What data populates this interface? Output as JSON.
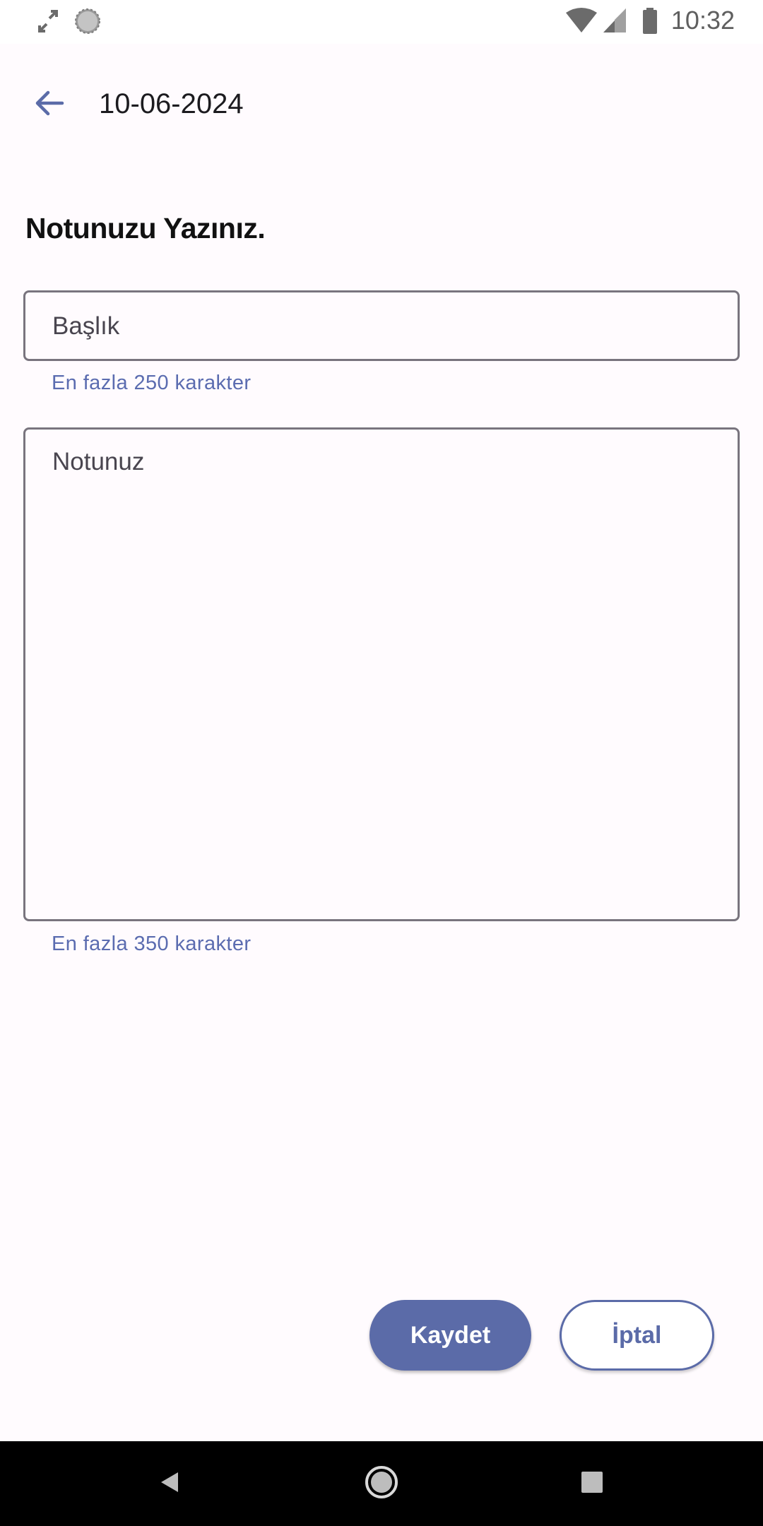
{
  "status_bar": {
    "time": "10:32",
    "left_icons": [
      "screen-rotate-icon",
      "sync-icon"
    ],
    "right_icons": [
      "wifi-icon",
      "cell-signal-icon",
      "battery-icon"
    ]
  },
  "app_bar": {
    "title": "10-06-2024",
    "back_icon": "arrow-back-icon"
  },
  "form": {
    "heading": "Notunuzu Yazınız.",
    "title_field": {
      "placeholder": "Başlık",
      "value": "",
      "helper": "En fazla 250 karakter"
    },
    "note_field": {
      "placeholder": "Notunuz",
      "value": "",
      "helper": "En fazla 350 karakter"
    }
  },
  "actions": {
    "save_label": "Kaydet",
    "cancel_label": "İptal"
  },
  "nav_bar": {
    "icons": [
      "back-triangle-icon",
      "home-circle-icon",
      "recents-square-icon"
    ]
  },
  "colors": {
    "accent": "#5b6ba8",
    "helper_text": "#5b6cb0",
    "outline": "#79747e",
    "background": "#fffbfe"
  }
}
